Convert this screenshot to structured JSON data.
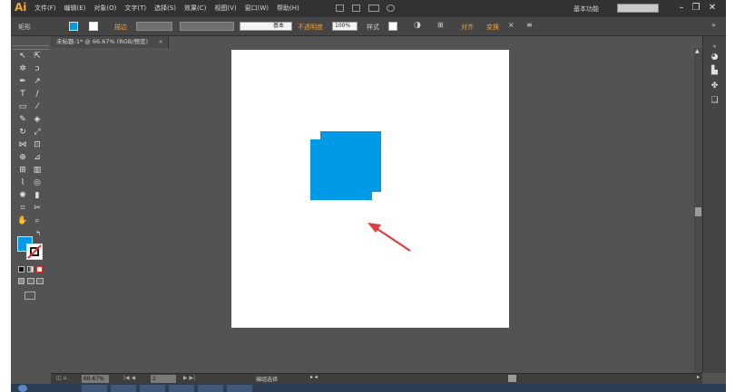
{
  "app": {
    "logo": "Ai"
  },
  "menu": [
    "文件(F)",
    "编辑(E)",
    "对象(O)",
    "文字(T)",
    "选择(S)",
    "效果(C)",
    "视图(V)",
    "窗口(W)",
    "帮助(H)"
  ],
  "workspace_label": "基本功能",
  "window_buttons": {
    "minimize": "–",
    "restore": "❐",
    "close": "✕"
  },
  "control_bar": {
    "selection_label": "矩形",
    "stroke_label": "描边",
    "brush_label": "基本",
    "opacity_label": "不透明度",
    "opacity_value": "100%",
    "style_label": "样式",
    "align_label": "对齐",
    "transform_label": "变换"
  },
  "document_tab": {
    "title": "未标题-1* @ 66.67% (RGB/预览)",
    "close": "×"
  },
  "status_bar": {
    "zoom": "66.67%",
    "page": "1",
    "tool_name": "编组选择"
  },
  "colors": {
    "fill": "#0099e6",
    "arrow": "#e23d3d",
    "artboard": "#ffffff",
    "ui_dark": "#535353"
  },
  "icons": {
    "tools": [
      "selection-tool-icon",
      "direct-selection-tool-icon",
      "magic-wand-tool-icon",
      "lasso-tool-icon",
      "pen-tool-icon",
      "curvature-tool-icon",
      "type-tool-icon",
      "line-segment-tool-icon",
      "rectangle-tool-icon",
      "paintbrush-tool-icon",
      "pencil-tool-icon",
      "eraser-tool-icon",
      "rotate-tool-icon",
      "scale-tool-icon",
      "width-tool-icon",
      "free-transform-tool-icon",
      "shape-builder-tool-icon",
      "perspective-grid-tool-icon",
      "mesh-tool-icon",
      "gradient-tool-icon",
      "eyedropper-tool-icon",
      "blend-tool-icon",
      "symbol-sprayer-tool-icon",
      "column-graph-tool-icon",
      "artboard-tool-icon",
      "slice-tool-icon",
      "hand-tool-icon",
      "zoom-tool-icon"
    ],
    "right_panel": [
      "color-panel-icon",
      "swatches-panel-icon",
      "brushes-panel-icon",
      "layers-panel-icon"
    ]
  }
}
